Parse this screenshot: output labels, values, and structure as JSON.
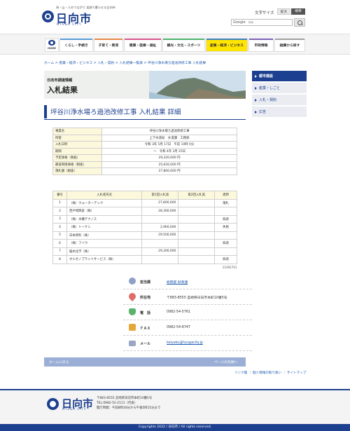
{
  "header": {
    "tagline": "海・山・人のつながり 笑顔で暮らせる日向市",
    "logo_text": "日向市",
    "logo_sub": "HYUGA CITY",
    "text_size_label": "文字サイズ",
    "size_large": "拡大",
    "size_standard": "標準",
    "search_provider": "Google",
    "search_sub": "検索"
  },
  "nav": {
    "home": "HOME",
    "items": [
      {
        "label": "くらし・手続き",
        "color": "#5a9bd6"
      },
      {
        "label": "子育て・教育",
        "color": "#e8894b"
      },
      {
        "label": "健康・医療・福祉",
        "color": "#d6558c"
      },
      {
        "label": "観光・文化・スポーツ",
        "color": "#4db36f"
      },
      {
        "label": "産業・経済・ビジネス",
        "color": "#3a7fc8"
      },
      {
        "label": "市政情報",
        "color": "#7b62b7"
      },
      {
        "label": "組織から探す",
        "color": "#a0a0a0"
      }
    ],
    "active_color": "#ffe500"
  },
  "breadcrumb": "ホーム > 産業・経済・ビジネス > 入札・契約 > 入札結果一覧表 > 坪谷川浄水場ろ過池改修工事 入札結果",
  "banner": {
    "pre": "日向市調達情報",
    "title": "入札結果"
  },
  "page_title": "坪谷川浄水場ろ過池改修工事 入札結果 詳細",
  "info_rows": [
    {
      "key": "事業名",
      "value": "坪谷川浄水場ろ過池改修工事"
    },
    {
      "key": "所管",
      "value": "上下水道局　水道課　工務係"
    },
    {
      "key": "入札日時",
      "value": "令和 3年 5月 17日　午前 10時 0分"
    },
    {
      "key": "期間",
      "value": "～　令和 4年 3月 25日"
    },
    {
      "key": "予定価格（税抜）",
      "value": "29,320,000 円"
    },
    {
      "key": "最低制限価格（税抜）",
      "value": "25,626,000 円"
    },
    {
      "key": "落札額（税抜）",
      "value": "27,800,000 円"
    }
  ],
  "bid_table": {
    "headers": [
      "番号",
      "入札者氏名",
      "第1回入札高",
      "第2回入札高",
      "適用"
    ],
    "rows": [
      {
        "no": "1",
        "name": "（株）ウォーターテック",
        "first": "27,800,000",
        "second": "",
        "note": "落札"
      },
      {
        "no": "2",
        "name": "西戸崎興産（株）",
        "first": "28,300,000",
        "second": "",
        "note": ""
      },
      {
        "no": "3",
        "name": "（株）水機テクノス",
        "first": "",
        "second": "",
        "note": "辞退"
      },
      {
        "no": "4",
        "name": "（株）トーケミ",
        "first": "2,900,000",
        "second": "",
        "note": "失格"
      },
      {
        "no": "5",
        "name": "日本原料（株）",
        "first": "29,500,000",
        "second": "",
        "note": ""
      },
      {
        "no": "6",
        "name": "（株）フソウ",
        "first": "",
        "second": "",
        "note": "辞退"
      },
      {
        "no": "7",
        "name": "稲水化学（株）",
        "first": "29,300,000",
        "second": "",
        "note": ""
      },
      {
        "no": "8",
        "name": "オルガノプラントサービス（株）",
        "first": "",
        "second": "",
        "note": "辞退"
      }
    ]
  },
  "record_id": "21091701",
  "contact": {
    "dept_label": "担当課",
    "dept_value": "総務部 財政課",
    "addr_label": "所在地",
    "addr_value": "〒883-8555 宮崎県日向市本町10番5号",
    "tel_label": "電　話",
    "tel_value": "0982-54-5761",
    "fax_label": "ＦＡＸ",
    "fax_value": "0982-54-8747",
    "mail_label": "メール",
    "mail_value": "keiyaku@hyugacity.jp"
  },
  "pager": {
    "prev": "ホームに戻る",
    "next": "ページの先頭へ"
  },
  "footer_links": "リンク集 ｜ 個人情報の取り扱い ｜ サイトマップ",
  "footer": {
    "logo_text": "日向市",
    "logo_sub": "HYUGA CITY",
    "addr1": "〒883-8555 宮崎県日向市本町10番5号",
    "addr2": "TEL:0982-52-2111（代表）",
    "addr3": "開庁時間：午前8時30分から午後5時15分まで",
    "copyright": "Copyrights 2022 / 日向市 / All rights reserved."
  },
  "sidebar": {
    "items": [
      "都市建設",
      "産業・しごと",
      "入札・契約",
      "広告"
    ]
  }
}
